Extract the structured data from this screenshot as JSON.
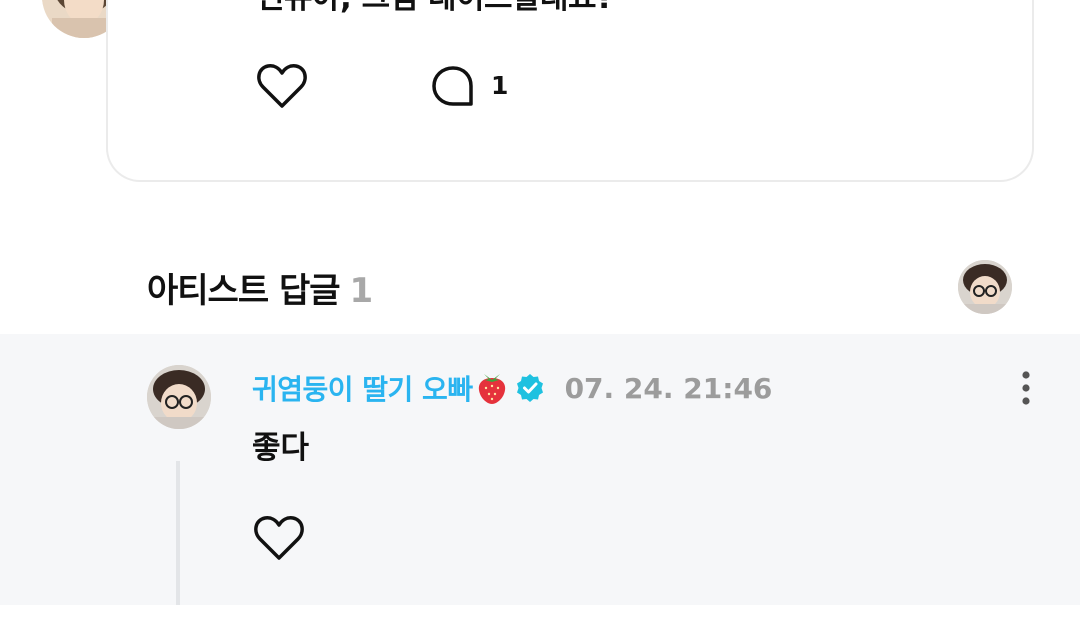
{
  "post": {
    "text": "신유아, 그럼 데이트할래요?",
    "comment_count": "1",
    "icons": {
      "like": "heart-outline-icon",
      "comment": "speech-bubble-icon"
    }
  },
  "artist_replies": {
    "title": "아티스트 답글",
    "count": "1"
  },
  "reply": {
    "author": "귀염둥이 딸기 오빠",
    "author_emoji": "strawberry",
    "verified": true,
    "timestamp": "07. 24. 21:46",
    "text": "좋다",
    "icons": {
      "like": "heart-outline-icon",
      "more": "more-vertical-icon",
      "badge": "verified-badge-icon"
    }
  },
  "colors": {
    "author_name": "#2ab4f0",
    "verified_badge": "#1fc1e0",
    "timestamp": "#9c9c9c",
    "reply_bg": "#f6f7f9",
    "count_gray": "#a8a8a8"
  }
}
